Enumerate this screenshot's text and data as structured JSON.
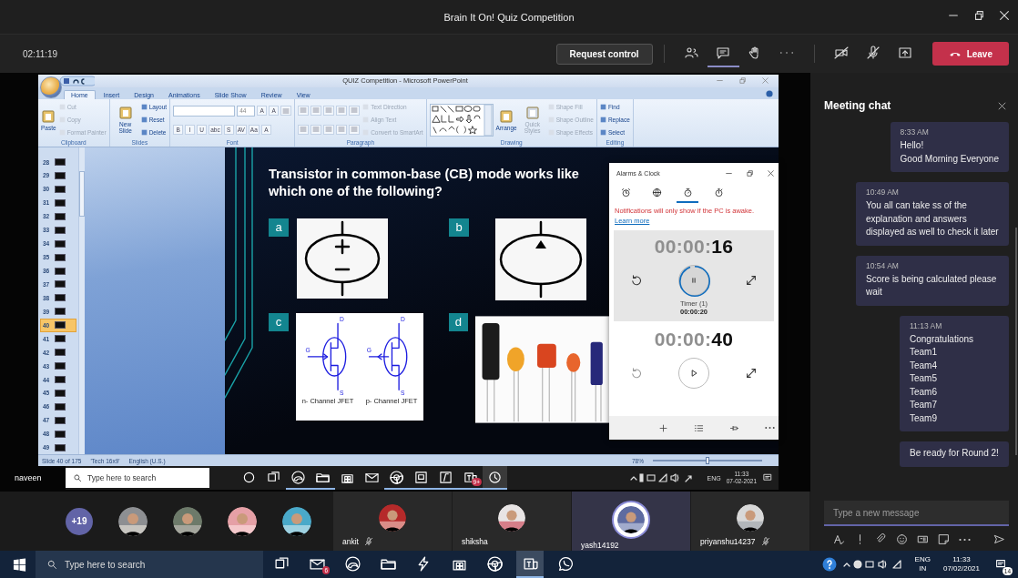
{
  "window": {
    "title": "Brain It On! Quiz Competition"
  },
  "meeting_bar": {
    "duration": "02:11:19",
    "request_control": "Request control",
    "tools": [
      {
        "kind": "people",
        "selected": false
      },
      {
        "kind": "chat",
        "selected": true
      },
      {
        "kind": "hand",
        "selected": false
      },
      {
        "kind": "more",
        "selected": false
      }
    ],
    "camera_on": false,
    "mic_on": false,
    "leave": "Leave"
  },
  "shared_screen": {
    "presenter": "naveen",
    "powerpoint": {
      "title": "QUIZ Competition - Microsoft PowerPoint",
      "tabs": [
        {
          "label": "Home",
          "selected": true
        },
        {
          "label": "Insert",
          "selected": false
        },
        {
          "label": "Design",
          "selected": false
        },
        {
          "label": "Animations",
          "selected": false
        },
        {
          "label": "Slide Show",
          "selected": false
        },
        {
          "label": "Review",
          "selected": false
        },
        {
          "label": "View",
          "selected": false
        }
      ],
      "ribbon_groups": [
        {
          "label": "Clipboard",
          "columns": [
            [
              {
                "kind": "large",
                "label": "Paste",
                "disabled": false
              }
            ],
            [
              {
                "kind": "small",
                "label": "Cut",
                "disabled": true
              },
              {
                "kind": "small",
                "label": "Copy",
                "disabled": true
              },
              {
                "kind": "small",
                "label": "Format Painter",
                "disabled": true
              }
            ]
          ]
        },
        {
          "label": "Slides",
          "columns": [
            [
              {
                "kind": "large",
                "label": "New Slide",
                "disabled": false
              }
            ],
            [
              {
                "kind": "small",
                "label": "Layout",
                "disabled": false
              },
              {
                "kind": "small",
                "label": "Reset",
                "disabled": false
              },
              {
                "kind": "small",
                "label": "Delete",
                "disabled": false
              }
            ]
          ]
        },
        {
          "label": "Font",
          "columns": [
            [
              {
                "kind": "toolrow",
                "parts": [
                  {
                    "kind": "field"
                  },
                  {
                    "kind": "field",
                    "value": "44"
                  },
                  {
                    "kind": "glyph",
                    "label": "A"
                  },
                  {
                    "kind": "glyph",
                    "label": "A"
                  },
                  {
                    "kind": "icon"
                  }
                ]
              },
              {
                "kind": "toolrow",
                "parts": [
                  {
                    "kind": "glyph",
                    "label": "B"
                  },
                  {
                    "kind": "glyph",
                    "label": "I"
                  },
                  {
                    "kind": "glyph",
                    "label": "U"
                  },
                  {
                    "kind": "glyph",
                    "label": "abc"
                  },
                  {
                    "kind": "glyph",
                    "label": "S"
                  },
                  {
                    "kind": "glyph",
                    "label": "AV"
                  },
                  {
                    "kind": "glyph",
                    "label": "Aa"
                  },
                  {
                    "kind": "glyph",
                    "label": "A"
                  }
                ]
              }
            ]
          ]
        },
        {
          "label": "Paragraph",
          "columns": [
            [
              {
                "kind": "toolrow",
                "parts": [
                  {
                    "kind": "icon"
                  },
                  {
                    "kind": "icon"
                  },
                  {
                    "kind": "icon"
                  },
                  {
                    "kind": "icon"
                  },
                  {
                    "kind": "icon"
                  }
                ]
              },
              {
                "kind": "toolrow",
                "parts": [
                  {
                    "kind": "icon"
                  },
                  {
                    "kind": "icon"
                  },
                  {
                    "kind": "icon"
                  },
                  {
                    "kind": "icon"
                  },
                  {
                    "kind": "icon"
                  }
                ]
              }
            ],
            [
              {
                "kind": "small",
                "label": "Text Direction",
                "disabled": true
              },
              {
                "kind": "small",
                "label": "Align Text",
                "disabled": true
              },
              {
                "kind": "small",
                "label": "Convert to SmartArt",
                "disabled": true
              }
            ]
          ]
        },
        {
          "label": "Drawing",
          "columns": [
            [
              {
                "kind": "gallery"
              }
            ],
            [
              {
                "kind": "large",
                "label": "Arrange",
                "disabled": false
              }
            ],
            [
              {
                "kind": "large",
                "label": "Quick Styles",
                "disabled": true
              }
            ],
            [
              {
                "kind": "small",
                "label": "Shape Fill",
                "disabled": true
              },
              {
                "kind": "small",
                "label": "Shape Outline",
                "disabled": true
              },
              {
                "kind": "small",
                "label": "Shape Effects",
                "disabled": true
              }
            ]
          ]
        },
        {
          "label": "Editing",
          "columns": [
            [
              {
                "kind": "small",
                "label": "Find",
                "disabled": false
              },
              {
                "kind": "small",
                "label": "Replace",
                "disabled": false
              },
              {
                "kind": "small",
                "label": "Select",
                "disabled": false
              }
            ]
          ]
        }
      ],
      "slide_thumbs": [
        {
          "number": "28",
          "selected": false
        },
        {
          "number": "29",
          "selected": false
        },
        {
          "number": "30",
          "selected": false
        },
        {
          "number": "31",
          "selected": false
        },
        {
          "number": "32",
          "selected": false
        },
        {
          "number": "33",
          "selected": false
        },
        {
          "number": "34",
          "selected": false
        },
        {
          "number": "35",
          "selected": false
        },
        {
          "number": "36",
          "selected": false
        },
        {
          "number": "37",
          "selected": false
        },
        {
          "number": "38",
          "selected": false
        },
        {
          "number": "39",
          "selected": false
        },
        {
          "number": "40",
          "selected": true
        },
        {
          "number": "41",
          "selected": false
        },
        {
          "number": "42",
          "selected": false
        },
        {
          "number": "43",
          "selected": false
        },
        {
          "number": "44",
          "selected": false
        },
        {
          "number": "45",
          "selected": false
        },
        {
          "number": "46",
          "selected": false
        },
        {
          "number": "47",
          "selected": false
        },
        {
          "number": "48",
          "selected": false
        },
        {
          "number": "49",
          "selected": false
        }
      ],
      "slide": {
        "question": "Transistor in common-base (CB) mode works like which one of the following?",
        "options": [
          {
            "letter": "a",
            "kind": "voltage-source"
          },
          {
            "letter": "b",
            "kind": "current-source"
          },
          {
            "letter": "c",
            "kind": "jfet",
            "pins": [
              [
                "D",
                "G",
                "S"
              ],
              [
                "D",
                "G",
                "S"
              ]
            ],
            "captions": [
              "n- Channel JFET",
              "p- Channel JFET"
            ]
          },
          {
            "letter": "d",
            "kind": "picture"
          }
        ]
      },
      "status": [
        "Slide 40 of 175",
        "'Tech 16x9'",
        "English (U.S.)"
      ],
      "zoom": {
        "reading": "78%",
        "level": 0.5
      }
    },
    "alarms_window": {
      "title": "Alarms & Clock",
      "tabs": [
        {
          "kind": "alarm",
          "selected": false
        },
        {
          "kind": "world-clock",
          "selected": false
        },
        {
          "kind": "timer",
          "selected": true
        },
        {
          "kind": "stopwatch",
          "selected": false
        }
      ],
      "notice": "Notifications will only show if the PC is awake.",
      "notice_link": "Learn more",
      "timers": [
        {
          "time_dim": "00:00:",
          "time_bold": "16",
          "running": true,
          "selected": true,
          "level": 0.95,
          "name": "Timer (1)",
          "total": "00:00:20"
        },
        {
          "time_dim": "00:00:",
          "time_bold": "40",
          "running": false,
          "selected": false
        }
      ]
    },
    "taskbar": {
      "search_placeholder": "Type here to search",
      "apps": [
        {
          "kind": "cortana",
          "running": false,
          "selected": false
        },
        {
          "kind": "task-view",
          "running": false,
          "selected": false
        },
        {
          "kind": "edge",
          "running": true,
          "selected": false
        },
        {
          "kind": "explorer",
          "running": true,
          "selected": false
        },
        {
          "kind": "store",
          "running": false,
          "selected": false
        },
        {
          "kind": "mail",
          "running": false,
          "selected": false
        },
        {
          "kind": "chrome",
          "running": true,
          "selected": false
        },
        {
          "kind": "slides",
          "running": true,
          "selected": false
        },
        {
          "kind": "f-app",
          "running": true,
          "selected": false
        },
        {
          "kind": "teams",
          "running": true,
          "selected": false,
          "badge": "9+"
        },
        {
          "kind": "clock",
          "running": true,
          "selected": true
        }
      ],
      "language": "ENG",
      "time": "11:33",
      "date": "07-02-2021"
    }
  },
  "participants": {
    "overflow": "+19",
    "tiles": [
      {
        "name": "ankit",
        "muted": true,
        "speaking": false
      },
      {
        "name": "shiksha",
        "muted": false,
        "speaking": false
      },
      {
        "name": "yash14192",
        "muted": false,
        "speaking": true
      },
      {
        "name": "priyanshu14237",
        "muted": true,
        "speaking": false
      }
    ]
  },
  "chat": {
    "title": "Meeting chat",
    "messages": [
      {
        "time": "8:33 AM",
        "lines": [
          "Hello!",
          "Good Morning Everyone"
        ]
      },
      {
        "time": "10:49 AM",
        "lines": [
          "You all can take ss of the explanation and answers displayed as well to check it later"
        ]
      },
      {
        "time": "10:54 AM",
        "lines": [
          "Score is being calculated please wait"
        ]
      },
      {
        "time": "11:13 AM",
        "lines": [
          "Congratulations",
          "Team1",
          "Team4",
          "Team5",
          "Team6",
          "Team7",
          "Team9"
        ]
      },
      {
        "lines": [
          "Be ready for Round 2!"
        ]
      }
    ],
    "compose_placeholder": "Type a new message"
  },
  "windows_taskbar": {
    "search_placeholder": "Type here to search",
    "apps": [
      {
        "kind": "task-view",
        "running": false,
        "selected": false
      },
      {
        "kind": "mail",
        "running": false,
        "selected": false,
        "badge": "6"
      },
      {
        "kind": "edge",
        "running": false,
        "selected": false
      },
      {
        "kind": "explorer",
        "running": false,
        "selected": false
      },
      {
        "kind": "code",
        "running": false,
        "selected": false
      },
      {
        "kind": "store",
        "running": false,
        "selected": false
      },
      {
        "kind": "chrome",
        "running": false,
        "selected": false
      },
      {
        "kind": "teams",
        "running": true,
        "selected": true
      },
      {
        "kind": "whatsapp",
        "running": false,
        "selected": false
      }
    ],
    "language": "ENG",
    "region": "IN",
    "time": "11:33",
    "date": "07/02/2021",
    "notifications": "14"
  }
}
